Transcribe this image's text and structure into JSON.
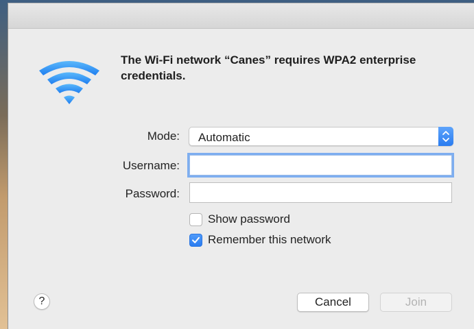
{
  "dialog": {
    "message": "The Wi-Fi network “Canes” requires WPA2 enterprise credentials.",
    "icon": "wifi-icon",
    "accent_color": "#2a7cf0"
  },
  "form": {
    "mode_label": "Mode:",
    "mode_value": "Automatic",
    "username_label": "Username:",
    "username_value": "",
    "password_label": "Password:",
    "password_value": ""
  },
  "options": {
    "show_password_label": "Show password",
    "show_password_checked": false,
    "remember_label": "Remember this network",
    "remember_checked": true
  },
  "buttons": {
    "help": "?",
    "cancel": "Cancel",
    "join": "Join"
  }
}
